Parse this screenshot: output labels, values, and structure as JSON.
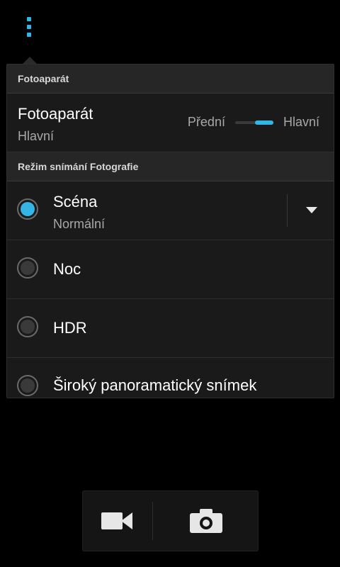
{
  "colors": {
    "accent": "#33b5e5",
    "background": "#000000",
    "panel": "#1a1a1a"
  },
  "menu": {
    "icon": "overflow-menu-icon"
  },
  "camera_section": {
    "header": "Fotoaparát",
    "title": "Fotoaparát",
    "value": "Hlavní",
    "switch": {
      "left_label": "Přední",
      "right_label": "Hlavní",
      "selected": "right"
    }
  },
  "mode_section": {
    "header": "Režim snímání Fotografie",
    "options": [
      {
        "label": "Scéna",
        "sub": "Normální",
        "selected": true,
        "has_dropdown": true
      },
      {
        "label": "Noc",
        "selected": false
      },
      {
        "label": "HDR",
        "selected": false
      },
      {
        "label": "Široký panoramatický snímek",
        "selected": false
      }
    ]
  },
  "dock": {
    "video_icon": "video-camera-icon",
    "photo_icon": "photo-camera-icon"
  }
}
